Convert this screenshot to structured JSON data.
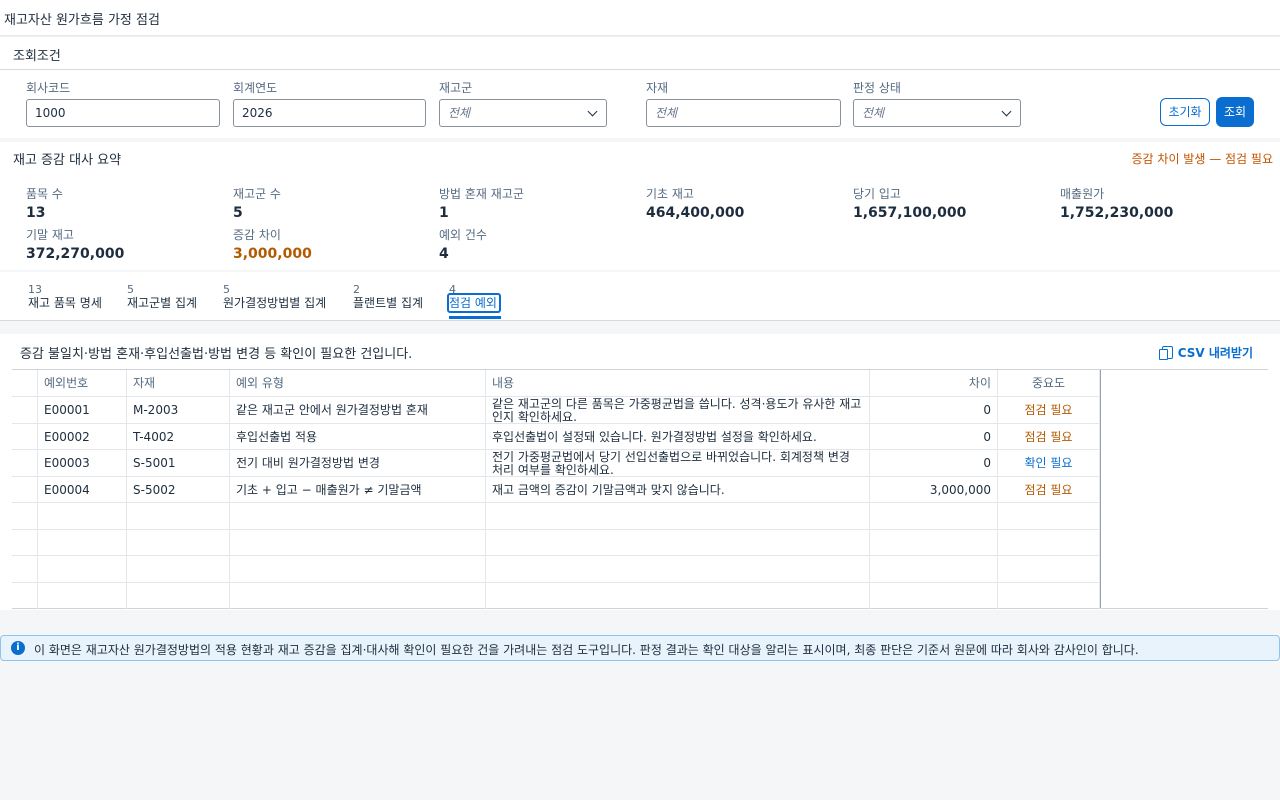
{
  "page": {
    "title": "재고자산 원가흐름 가정 점검"
  },
  "filters": {
    "section_title": "조회조건",
    "company_code": {
      "label": "회사코드",
      "value": "1000"
    },
    "fiscal_year": {
      "label": "회계연도",
      "value": "2026"
    },
    "inventory_group": {
      "label": "재고군",
      "value": "전체"
    },
    "material": {
      "label": "자재",
      "placeholder": "전체"
    },
    "judgment_status": {
      "label": "판정 상태",
      "value": "전체"
    },
    "reset_label": "초기화",
    "search_label": "조회"
  },
  "summary": {
    "title": "재고 증감 대사 요약",
    "warning": "증감 차이 발생 — 점검 필요",
    "kpis": [
      {
        "label": "품목 수",
        "value": "13"
      },
      {
        "label": "재고군 수",
        "value": "5"
      },
      {
        "label": "방법 혼재 재고군",
        "value": "1"
      },
      {
        "label": "기초 재고",
        "value": "464,400,000"
      },
      {
        "label": "당기 입고",
        "value": "1,657,100,000"
      },
      {
        "label": "매출원가",
        "value": "1,752,230,000"
      },
      {
        "label": "기말 재고",
        "value": "372,270,000"
      },
      {
        "label": "증감 차이",
        "value": "3,000,000"
      },
      {
        "label": "예외 건수",
        "value": "4"
      }
    ]
  },
  "tabs": [
    {
      "count": "13",
      "label": "재고 품목 명세"
    },
    {
      "count": "5",
      "label": "재고군별 집계"
    },
    {
      "count": "5",
      "label": "원가결정방법별 집계"
    },
    {
      "count": "2",
      "label": "플랜트별 집계"
    },
    {
      "count": "4",
      "label": "점검 예외"
    }
  ],
  "exceptions": {
    "description": "증감 불일치·방법 혼재·후입선출법·방법 변경 등 확인이 필요한 건입니다.",
    "csv_label": "CSV 내려받기",
    "columns": [
      "예외번호",
      "자재",
      "예외 유형",
      "내용",
      "차이",
      "중요도"
    ],
    "rows": [
      {
        "id": "E00001",
        "material": "M-2003",
        "type": "같은 재고군 안에서 원가결정방법 혼재",
        "content": "같은 재고군의 다른 품목은 가중평균법을 씁니다. 성격·용도가 유사한 재고인지 확인하세요.",
        "diff": "0",
        "severity": "점검 필요"
      },
      {
        "id": "E00002",
        "material": "T-4002",
        "type": "후입선출법 적용",
        "content": "후입선출법이 설정돼 있습니다. 원가결정방법 설정을 확인하세요.",
        "diff": "0",
        "severity": "점검 필요"
      },
      {
        "id": "E00003",
        "material": "S-5001",
        "type": "전기 대비 원가결정방법 변경",
        "content": "전기 가중평균법에서 당기 선입선출법으로 바뀌었습니다. 회계정책 변경 처리 여부를 확인하세요.",
        "diff": "0",
        "severity": "확인 필요"
      },
      {
        "id": "E00004",
        "material": "S-5002",
        "type": "기초 + 입고 − 매출원가 ≠ 기말금액",
        "content": "재고 금액의 증감이 기말금액과 맞지 않습니다.",
        "diff": "3,000,000",
        "severity": "점검 필요"
      }
    ]
  },
  "info": {
    "text": "이 화면은 재고자산 원가결정방법의 적용 현황과 재고 증감을 집계·대사해 확인이 필요한 건을 가려내는 점검 도구입니다. 판정 결과는 확인 대상을 알리는 표시이며, 최종 판단은 기준서 원문에 따라 회사와 감사인이 합니다."
  },
  "colors": {
    "accent": "#0a6ed1",
    "warning": "#b35a00"
  }
}
